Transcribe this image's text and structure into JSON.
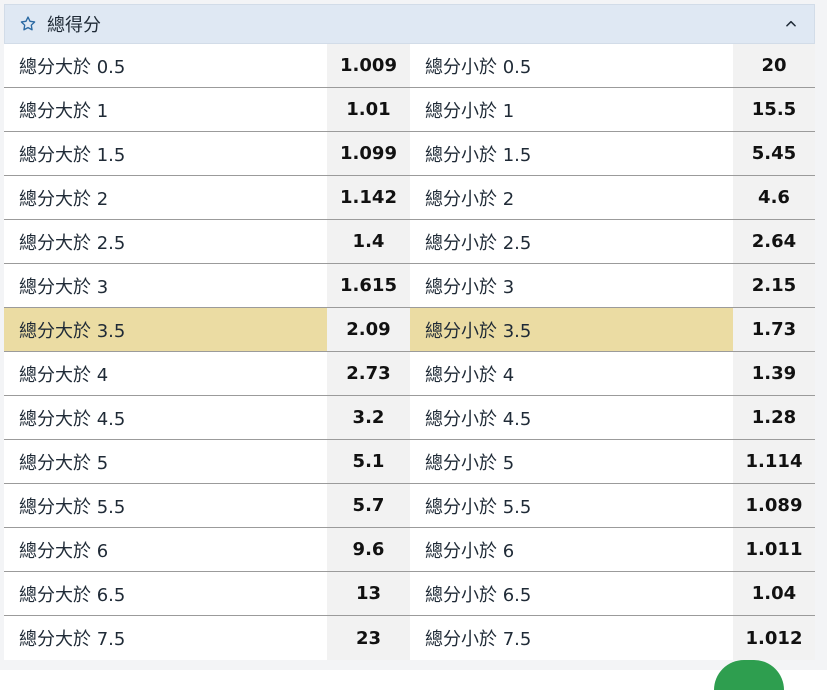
{
  "header": {
    "title": "總得分",
    "star_icon": "star-outline-icon",
    "collapse_icon": "chevron-up-icon"
  },
  "rows": [
    {
      "over_label": "總分大於 0.5",
      "over_odds": "1.009",
      "under_label": "總分小於 0.5",
      "under_odds": "20",
      "highlight": false
    },
    {
      "over_label": "總分大於 1",
      "over_odds": "1.01",
      "under_label": "總分小於 1",
      "under_odds": "15.5",
      "highlight": false
    },
    {
      "over_label": "總分大於 1.5",
      "over_odds": "1.099",
      "under_label": "總分小於 1.5",
      "under_odds": "5.45",
      "highlight": false
    },
    {
      "over_label": "總分大於 2",
      "over_odds": "1.142",
      "under_label": "總分小於 2",
      "under_odds": "4.6",
      "highlight": false
    },
    {
      "over_label": "總分大於 2.5",
      "over_odds": "1.4",
      "under_label": "總分小於 2.5",
      "under_odds": "2.64",
      "highlight": false
    },
    {
      "over_label": "總分大於 3",
      "over_odds": "1.615",
      "under_label": "總分小於 3",
      "under_odds": "2.15",
      "highlight": false
    },
    {
      "over_label": "總分大於 3.5",
      "over_odds": "2.09",
      "under_label": "總分小於 3.5",
      "under_odds": "1.73",
      "highlight": true
    },
    {
      "over_label": "總分大於 4",
      "over_odds": "2.73",
      "under_label": "總分小於 4",
      "under_odds": "1.39",
      "highlight": false
    },
    {
      "over_label": "總分大於 4.5",
      "over_odds": "3.2",
      "under_label": "總分小於 4.5",
      "under_odds": "1.28",
      "highlight": false
    },
    {
      "over_label": "總分大於 5",
      "over_odds": "5.1",
      "under_label": "總分小於 5",
      "under_odds": "1.114",
      "highlight": false
    },
    {
      "over_label": "總分大於 5.5",
      "over_odds": "5.7",
      "under_label": "總分小於 5.5",
      "under_odds": "1.089",
      "highlight": false
    },
    {
      "over_label": "總分大於 6",
      "over_odds": "9.6",
      "under_label": "總分小於 6",
      "under_odds": "1.011",
      "highlight": false
    },
    {
      "over_label": "總分大於 6.5",
      "over_odds": "13",
      "under_label": "總分小於 6.5",
      "under_odds": "1.04",
      "highlight": false
    },
    {
      "over_label": "總分大於 7.5",
      "over_odds": "23",
      "under_label": "總分小於 7.5",
      "under_odds": "1.012",
      "highlight": false
    }
  ],
  "colors": {
    "header_bg": "#dfe8f3",
    "highlight_bg": "#ebdca3",
    "odds_bg": "#f2f2f2",
    "accent": "#2c6aa3"
  }
}
